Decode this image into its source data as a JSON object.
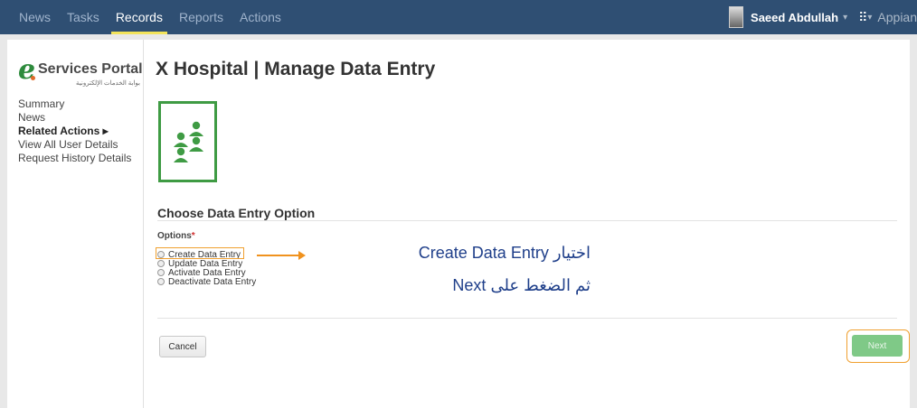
{
  "nav": {
    "tabs": [
      {
        "label": "News"
      },
      {
        "label": "Tasks"
      },
      {
        "label": "Records"
      },
      {
        "label": "Reports"
      },
      {
        "label": "Actions"
      }
    ],
    "active_tab": "Records",
    "user_name": "Saeed Abdullah",
    "user_caret": "▾",
    "apps_icon": "grid-icon",
    "app_name": "Appian"
  },
  "sidebar": {
    "logo_main": "Services Portal",
    "logo_letter": "e",
    "logo_arabic": "بوابة الخدمات الإلكترونية",
    "links": [
      {
        "label": "Summary"
      },
      {
        "label": "News"
      },
      {
        "label": "Related Actions ▸"
      },
      {
        "label": "View All User Details"
      },
      {
        "label": "Request History Details"
      }
    ]
  },
  "main": {
    "title": "X Hospital | Manage Data Entry",
    "record_icon": "people-group-icon",
    "record_icon_color": "#3f9b44",
    "section_title": "Choose Data Entry Option",
    "options_label": "Options",
    "required_mark": "*",
    "options": [
      {
        "label": "Create Data Entry",
        "highlighted": true
      },
      {
        "label": "Update Data Entry"
      },
      {
        "label": "Activate Data Entry"
      },
      {
        "label": "Deactivate Data Entry"
      }
    ],
    "annotation_line1": "اختيار Create Data Entry",
    "annotation_line2": "ثم الضغط على Next",
    "annotation_color": "#1f3f8a",
    "highlight_color": "#f0a030",
    "cancel_label": "Cancel",
    "next_label": "Next"
  }
}
